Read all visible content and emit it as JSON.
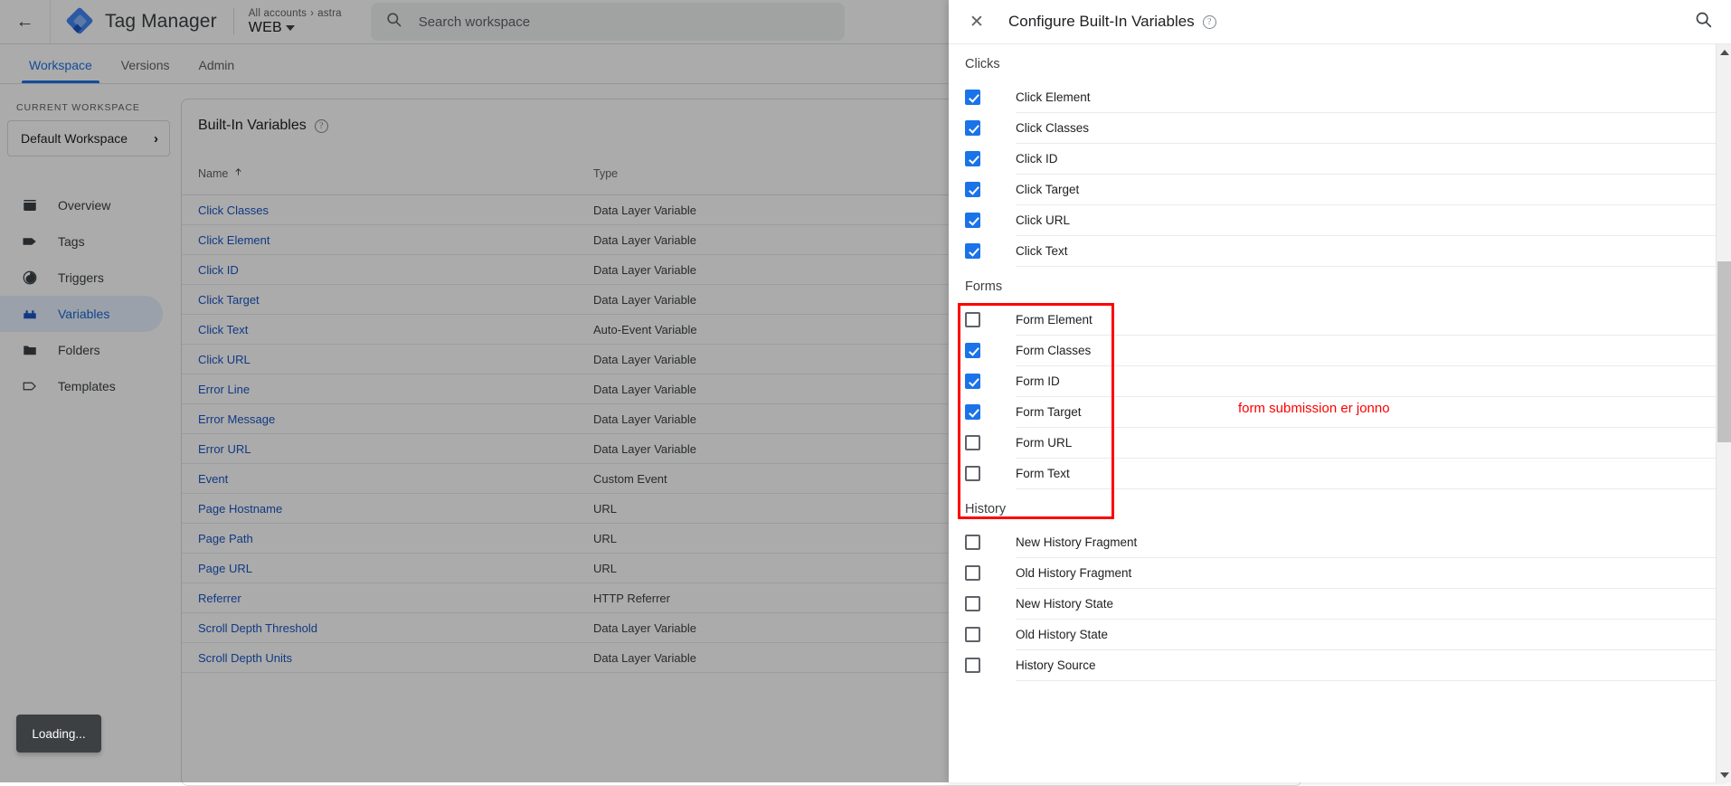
{
  "header": {
    "back_icon": "back-arrow-icon",
    "logo_icon": "tag-manager-logo",
    "product_title": "Tag Manager",
    "breadcrumb_accounts": "All accounts",
    "breadcrumb_sep": "›",
    "breadcrumb_account": "astra",
    "container_name": "WEB",
    "search": {
      "icon": "search-icon",
      "placeholder": "Search workspace",
      "value": ""
    }
  },
  "tabs": [
    {
      "label": "Workspace",
      "active": true
    },
    {
      "label": "Versions",
      "active": false
    },
    {
      "label": "Admin",
      "active": false
    }
  ],
  "sidebar": {
    "section_label": "CURRENT WORKSPACE",
    "workspace_name": "Default Workspace",
    "workspace_chevron": "›",
    "items": [
      {
        "label": "Overview",
        "icon": "overview-icon",
        "active": false
      },
      {
        "label": "Tags",
        "icon": "tag-icon",
        "active": false
      },
      {
        "label": "Triggers",
        "icon": "trigger-icon",
        "active": false
      },
      {
        "label": "Variables",
        "icon": "variable-icon",
        "active": true
      },
      {
        "label": "Folders",
        "icon": "folder-icon",
        "active": false
      },
      {
        "label": "Templates",
        "icon": "template-icon",
        "active": false
      }
    ]
  },
  "main": {
    "card_title": "Built-In Variables",
    "help_icon": "help-icon",
    "columns": [
      {
        "label": "Name",
        "sort_icon": "sort-asc-arrow"
      },
      {
        "label": "Type"
      }
    ],
    "rows": [
      {
        "name": "Click Classes",
        "type": "Data Layer Variable"
      },
      {
        "name": "Click Element",
        "type": "Data Layer Variable"
      },
      {
        "name": "Click ID",
        "type": "Data Layer Variable"
      },
      {
        "name": "Click Target",
        "type": "Data Layer Variable"
      },
      {
        "name": "Click Text",
        "type": "Auto-Event Variable"
      },
      {
        "name": "Click URL",
        "type": "Data Layer Variable"
      },
      {
        "name": "Error Line",
        "type": "Data Layer Variable"
      },
      {
        "name": "Error Message",
        "type": "Data Layer Variable"
      },
      {
        "name": "Error URL",
        "type": "Data Layer Variable"
      },
      {
        "name": "Event",
        "type": "Custom Event"
      },
      {
        "name": "Page Hostname",
        "type": "URL"
      },
      {
        "name": "Page Path",
        "type": "URL"
      },
      {
        "name": "Page URL",
        "type": "URL"
      },
      {
        "name": "Referrer",
        "type": "HTTP Referrer"
      },
      {
        "name": "Scroll Depth Threshold",
        "type": "Data Layer Variable"
      },
      {
        "name": "Scroll Depth Units",
        "type": "Data Layer Variable"
      }
    ]
  },
  "toast": {
    "text": "Loading..."
  },
  "dialog": {
    "close_icon": "close-icon",
    "title": "Configure Built-In Variables",
    "help_icon": "help-icon",
    "search_icon": "search-icon",
    "groups": [
      {
        "title": "Clicks",
        "options": [
          {
            "label": "Click Element",
            "checked": true
          },
          {
            "label": "Click Classes",
            "checked": true
          },
          {
            "label": "Click ID",
            "checked": true
          },
          {
            "label": "Click Target",
            "checked": true
          },
          {
            "label": "Click URL",
            "checked": true
          },
          {
            "label": "Click Text",
            "checked": true
          }
        ]
      },
      {
        "title": "Forms",
        "highlighted": true,
        "options": [
          {
            "label": "Form Element",
            "checked": false
          },
          {
            "label": "Form Classes",
            "checked": true
          },
          {
            "label": "Form ID",
            "checked": true
          },
          {
            "label": "Form Target",
            "checked": true
          },
          {
            "label": "Form URL",
            "checked": false
          },
          {
            "label": "Form Text",
            "checked": false
          }
        ]
      },
      {
        "title": "History",
        "options": [
          {
            "label": "New History Fragment",
            "checked": false
          },
          {
            "label": "Old History Fragment",
            "checked": false
          },
          {
            "label": "New History State",
            "checked": false
          },
          {
            "label": "Old History State",
            "checked": false
          },
          {
            "label": "History Source",
            "checked": false
          }
        ]
      }
    ],
    "annotation": {
      "text": "form submission er jonno",
      "color": "#ff0000"
    },
    "scrollbar": {
      "up_icon": "scroll-up-arrow",
      "down_icon": "scroll-down-arrow"
    }
  },
  "colors": {
    "accent": "#1a73e8",
    "link": "#1a56c4",
    "annotation": "#ff0000",
    "toast_bg": "#3c4043"
  }
}
